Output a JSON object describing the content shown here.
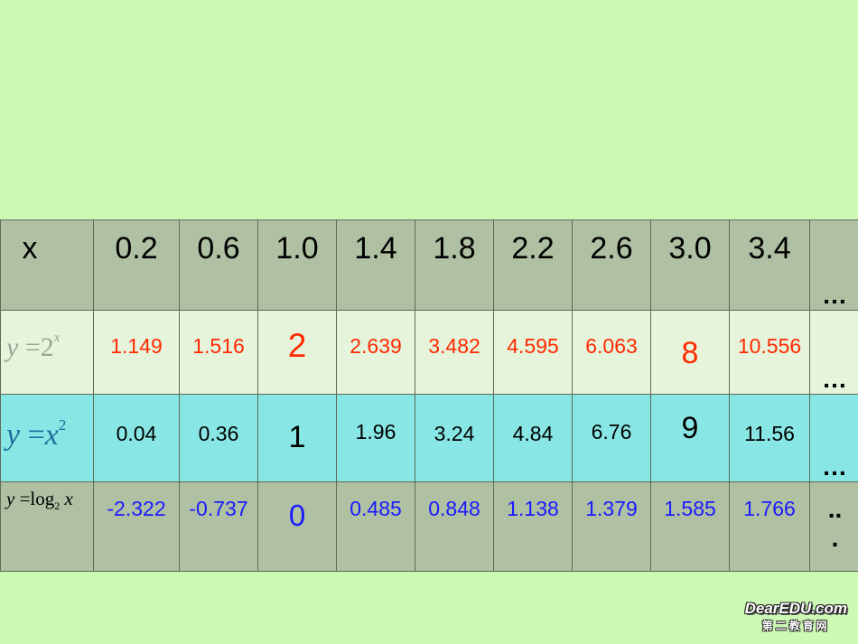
{
  "table": {
    "header": {
      "label": "x",
      "values": [
        "0.2",
        "0.6",
        "1.0",
        "1.4",
        "1.8",
        "2.2",
        "2.6",
        "3.0",
        "3.4"
      ],
      "ellipsis": "…"
    },
    "row_2x": {
      "label": "y =2^x",
      "label_parts": {
        "y": "y",
        "eq": " =2",
        "exp": "x"
      },
      "values": [
        "1.149",
        "1.516",
        "2",
        "2.639",
        "3.482",
        "4.595",
        "6.063",
        "8",
        "10.556"
      ],
      "ellipsis": "…"
    },
    "row_x2": {
      "label": "y =x^2",
      "label_parts": {
        "y": "y",
        "eq": " =",
        "base": "x",
        "exp": "2"
      },
      "values": [
        "0.04",
        "0.36",
        "1",
        "1.96",
        "3.24",
        "4.84",
        "6.76",
        "9",
        "11.56"
      ],
      "ellipsis": "…"
    },
    "row_log": {
      "label": "y =log2 x",
      "label_parts": {
        "y": "y",
        "eq": " =",
        "log": "log",
        "base": "2",
        "arg": " x"
      },
      "values": [
        "-2.322",
        "-0.737",
        "0",
        "0.485",
        "0.848",
        "1.138",
        "1.379",
        "1.585",
        "1.766"
      ],
      "ellipsis_top": "..",
      "ellipsis_bottom": "."
    }
  },
  "colors": {
    "background": "#ccfab4",
    "row_header_bg": "#afc0a3",
    "row_2x_bg": "#e6f4dc",
    "row_x2_bg": "#88e7e4",
    "row_log_bg": "#afc0a3",
    "values_2x": "#ff2a00",
    "values_x2": "#000000",
    "values_log": "#1a1aff"
  },
  "watermark": {
    "main": "DearEDU.com",
    "sub": "第二教育网"
  }
}
